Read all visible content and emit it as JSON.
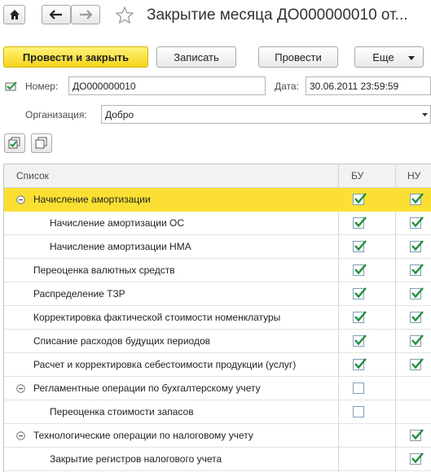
{
  "window": {
    "title": "Закрытие месяца ДО000000010 от..."
  },
  "toolbar": {
    "post_and_close_label": "Провести и закрыть",
    "save_label": "Записать",
    "post_label": "Провести",
    "more_label": "Еще"
  },
  "form": {
    "number_label": "Номер:",
    "number_value": "ДО000000010",
    "date_label": "Дата:",
    "date_value": "30.06.2011 23:59:59",
    "org_label": "Организация:",
    "org_value": "Добро"
  },
  "table": {
    "columns": [
      "Список",
      "БУ",
      "НУ"
    ],
    "rows": [
      {
        "label": "Начисление амортизации",
        "level": 0,
        "group": true,
        "bu": true,
        "nu": true
      },
      {
        "label": "Начисление амортизации ОС",
        "level": 1,
        "group": false,
        "bu": true,
        "nu": true
      },
      {
        "label": "Начисление амортизации НМА",
        "level": 1,
        "group": false,
        "bu": true,
        "nu": true
      },
      {
        "label": "Переоценка валютных средств",
        "level": 0,
        "group": false,
        "bu": true,
        "nu": true
      },
      {
        "label": "Распределение ТЗР",
        "level": 0,
        "group": false,
        "bu": true,
        "nu": true
      },
      {
        "label": "Корректировка фактической стоимости номенклатуры",
        "level": 0,
        "group": false,
        "bu": true,
        "nu": true
      },
      {
        "label": "Списание расходов будущих периодов",
        "level": 0,
        "group": false,
        "bu": true,
        "nu": true
      },
      {
        "label": "Расчет и корректировка себестоимости продукции (услуг)",
        "level": 0,
        "group": false,
        "bu": true,
        "nu": true
      },
      {
        "label": "Регламентные операции по бухгалтерскому учету",
        "level": 0,
        "group": true,
        "bu": false,
        "nu": null
      },
      {
        "label": "Переоценка стоимости запасов",
        "level": 1,
        "group": false,
        "bu": false,
        "nu": null
      },
      {
        "label": "Технологические операции по налоговому учету",
        "level": 0,
        "group": true,
        "bu": null,
        "nu": true
      },
      {
        "label": "Закрытие регистров налогового учета",
        "level": 1,
        "group": false,
        "bu": null,
        "nu": true
      }
    ]
  },
  "colors": {
    "selected_row": "#fbe033",
    "primary_button": "#f5d61a",
    "checkmark": "#1f8f3a"
  }
}
